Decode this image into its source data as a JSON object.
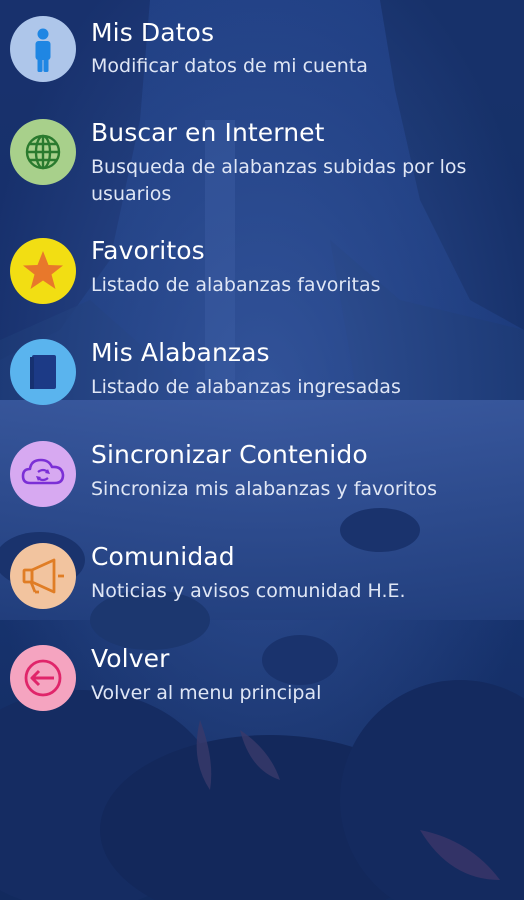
{
  "colors": {
    "background": "#16306a",
    "text_primary": "#ffffff",
    "text_secondary": "#dfe6f5"
  },
  "menu": {
    "items": [
      {
        "id": "mis-datos",
        "title": "Mis Datos",
        "subtitle": "Modificar datos de mi cuenta",
        "icon": "person-icon",
        "icon_bg": "#aec6ea",
        "icon_fg": "#1f86e3"
      },
      {
        "id": "buscar-en-internet",
        "title": "Buscar en Internet",
        "subtitle": "Busqueda de alabanzas subidas por los usuarios",
        "icon": "globe-icon",
        "icon_bg": "#a8d08b",
        "icon_fg": "#2a7a2e"
      },
      {
        "id": "favoritos",
        "title": "Favoritos",
        "subtitle": "Listado de alabanzas favoritas",
        "icon": "star-icon",
        "icon_bg": "#f2de13",
        "icon_fg": "#e8782b"
      },
      {
        "id": "mis-alabanzas",
        "title": "Mis Alabanzas",
        "subtitle": "Listado de alabanzas ingresadas",
        "icon": "book-icon",
        "icon_bg": "#5ab4ee",
        "icon_fg": "#1c3a86"
      },
      {
        "id": "sincronizar-contenido",
        "title": "Sincronizar Contenido",
        "subtitle": "Sincroniza mis alabanzas y favoritos",
        "icon": "cloud-sync-icon",
        "icon_bg": "#d7a9f1",
        "icon_fg": "#7b2fd6"
      },
      {
        "id": "comunidad",
        "title": "Comunidad",
        "subtitle": "Noticias y avisos comunidad H.E.",
        "icon": "megaphone-icon",
        "icon_bg": "#f2c49f",
        "icon_fg": "#e07d25"
      },
      {
        "id": "volver",
        "title": "Volver",
        "subtitle": "Volver al menu principal",
        "icon": "back-arrow-icon",
        "icon_bg": "#f5a4c0",
        "icon_fg": "#e0256a"
      }
    ]
  }
}
